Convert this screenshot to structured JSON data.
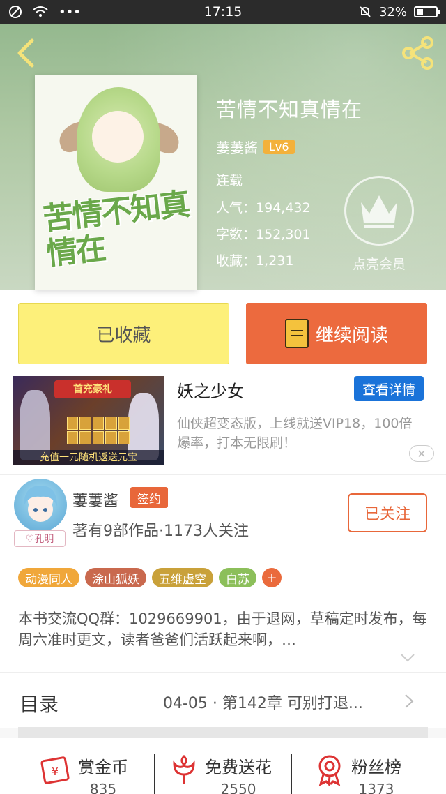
{
  "status_bar": {
    "time": "17:15",
    "battery": "32%"
  },
  "book": {
    "title": "苦情不知真情在",
    "author": "萋萋酱",
    "level": "Lv6",
    "status": "连载",
    "popularity_label": "人气：",
    "popularity": "194,432",
    "words_label": "字数：",
    "words": "152,301",
    "favorites_label": "收藏：",
    "favorites": "1,231",
    "vip_label": "点亮会员",
    "cover_art_text": "苦情不知真情在"
  },
  "actions": {
    "collected": "已收藏",
    "continue_read": "继续阅读"
  },
  "ad": {
    "title": "妖之少女",
    "detail_button": "查看详情",
    "description": "仙侠超变态版，上线就送VIP18，100倍爆率，打本无限刷！",
    "image_banner": "首充豪礼",
    "image_footer": "充值一元随机返送元宝"
  },
  "author_card": {
    "name": "萋萋酱",
    "sign_badge": "签约",
    "info": "著有9部作品·1173人关注",
    "follow_button": "已关注",
    "avatar_tag": "♡孔明"
  },
  "tags": [
    {
      "label": "动漫同人",
      "color": "#f0a73a"
    },
    {
      "label": "涂山狐妖",
      "color": "#c9694e"
    },
    {
      "label": "五维虚空",
      "color": "#c9a13a"
    },
    {
      "label": "白苏",
      "color": "#8cbf5a"
    }
  ],
  "tag_add": "+",
  "description": "本书交流QQ群：1029669901，由于退网，草稿定时发布，每周六准时更文，读者爸爸们活跃起来啊，…",
  "catalog": {
    "label": "目录",
    "latest": "04-05 · 第142章 可别打退..."
  },
  "stats": [
    {
      "label": "赏金币",
      "value": "835",
      "icon": "red-envelope-icon"
    },
    {
      "label": "免费送花",
      "value": "2550",
      "icon": "flower-icon"
    },
    {
      "label": "粉丝榜",
      "value": "1373",
      "icon": "medal-icon"
    }
  ],
  "colors": {
    "accent": "#e8673a",
    "collect_bg": "#fdf07a",
    "ad_button": "#1a73d9"
  }
}
